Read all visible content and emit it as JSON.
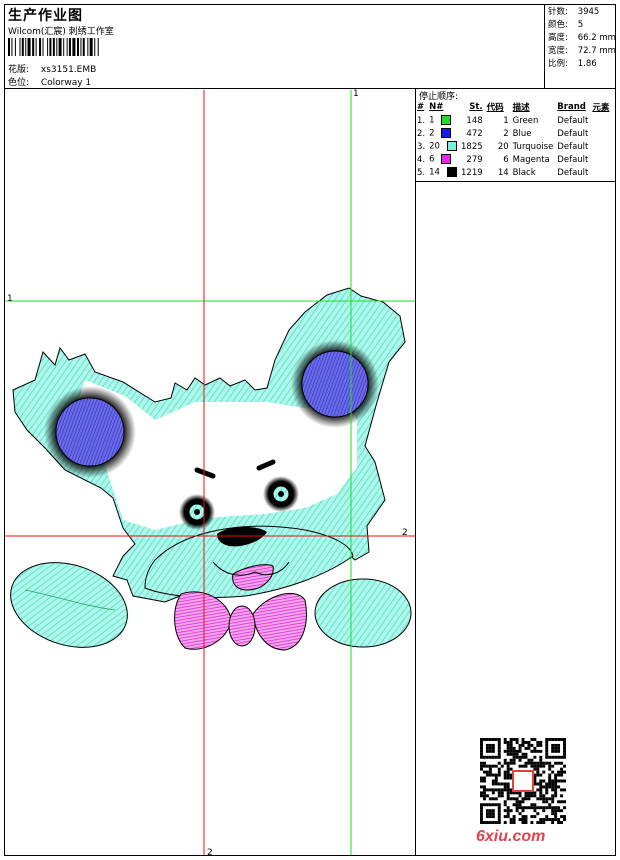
{
  "header": {
    "title": "生产作业图",
    "company": "Wilcom(汇宸)  刺绣工作室",
    "design_label": "花版:",
    "design_value": "xs3151.EMB",
    "colorway_label": "色位:",
    "colorway_value": "Colorway 1"
  },
  "stats": {
    "stitches_label": "针数:",
    "stitches_value": "3945",
    "colors_label": "颜色:",
    "colors_value": "5",
    "height_label": "高度:",
    "height_value": "66.2 mm",
    "width_label": "宽度:",
    "width_value": "72.7 mm",
    "scale_label": "比例:",
    "scale_value": "1.86"
  },
  "stop_sequence": {
    "title": "停止顺序:",
    "headers": [
      "#",
      "N#",
      "St.",
      "代码",
      "描述",
      "Brand",
      "元素"
    ],
    "rows": [
      {
        "idx": "1.",
        "n": "1",
        "st": "148",
        "code": "1",
        "desc": "Green",
        "brand": "Default",
        "color": "#22dd22"
      },
      {
        "idx": "2.",
        "n": "2",
        "st": "472",
        "code": "2",
        "desc": "Blue",
        "brand": "Default",
        "color": "#1a1aee"
      },
      {
        "idx": "3.",
        "n": "20",
        "st": "1825",
        "code": "20",
        "desc": "Turquoise",
        "brand": "Default",
        "color": "#7af0dc"
      },
      {
        "idx": "4.",
        "n": "6",
        "st": "279",
        "code": "6",
        "desc": "Magenta",
        "brand": "Default",
        "color": "#ee22ee"
      },
      {
        "idx": "5.",
        "n": "14",
        "st": "1219",
        "code": "14",
        "desc": "Black",
        "brand": "Default",
        "color": "#000000"
      }
    ]
  },
  "guides": {
    "v1_top": "1",
    "h1_left": "1",
    "h2_right": "2",
    "v2_bottom": "2"
  },
  "colors": {
    "guide_green": "#22dd22",
    "guide_red": "#ee1111",
    "turquoise": "#7ef2dc",
    "blue": "#3b3bd0",
    "magenta": "#e83ad8",
    "watermark": "#e0434b"
  },
  "watermark": "6xiu.com"
}
